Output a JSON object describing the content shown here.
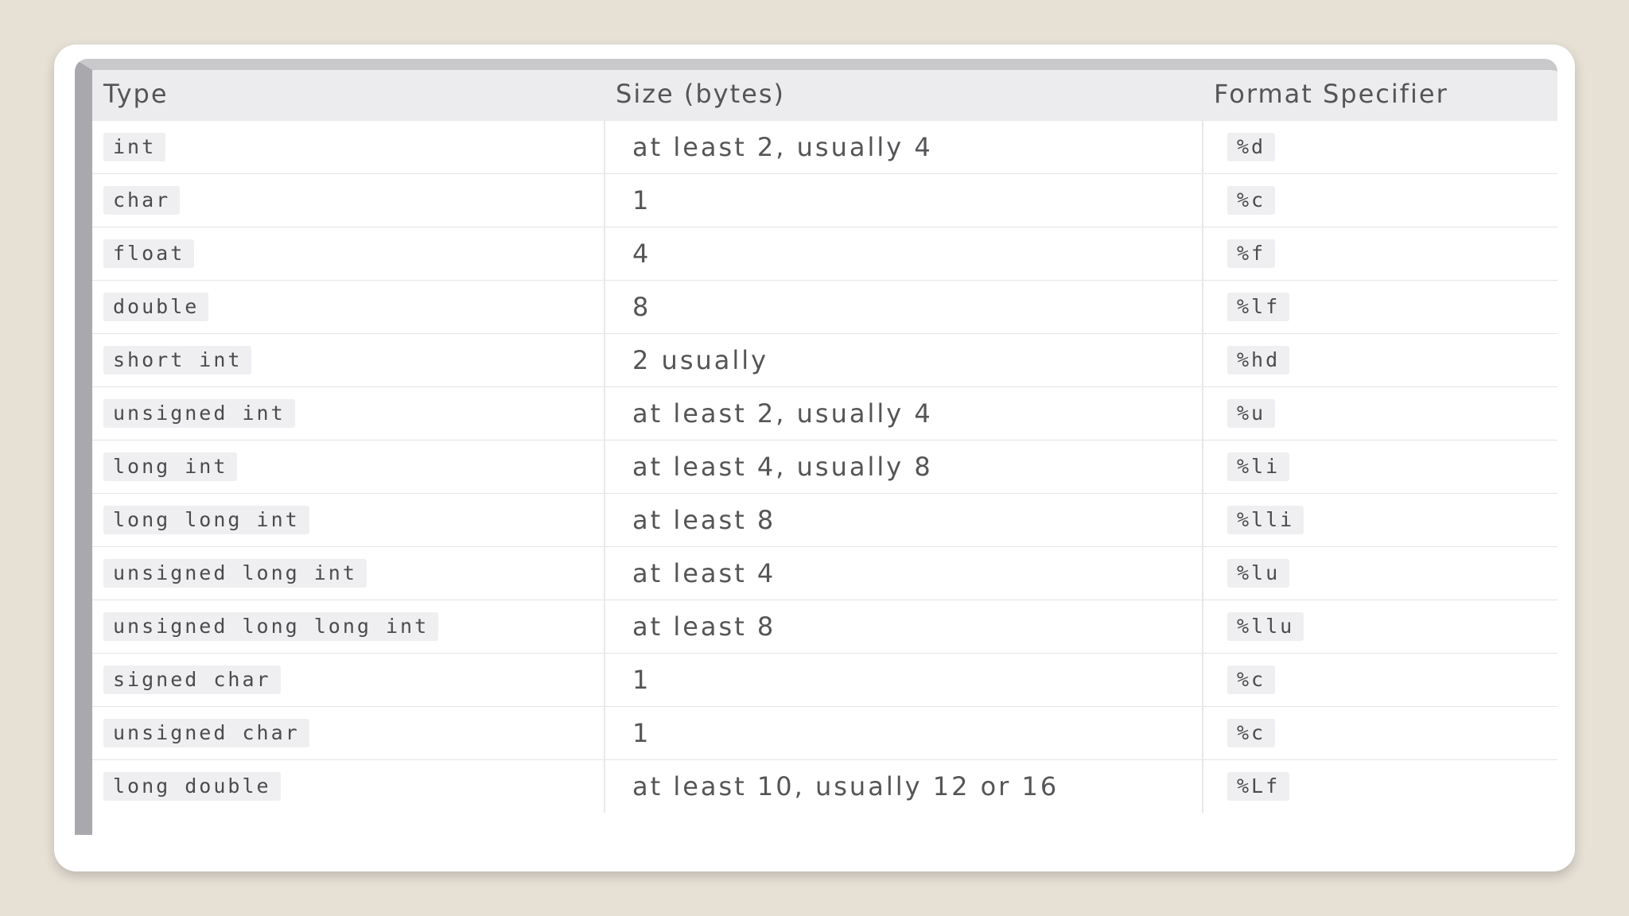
{
  "table": {
    "headers": {
      "type": "Type",
      "size": "Size (bytes)",
      "format": "Format Specifier"
    },
    "rows": [
      {
        "type": "int",
        "size": "at least 2, usually 4",
        "format": "%d"
      },
      {
        "type": "char",
        "size": "1",
        "format": "%c"
      },
      {
        "type": "float",
        "size": "4",
        "format": "%f"
      },
      {
        "type": "double",
        "size": "8",
        "format": "%lf"
      },
      {
        "type": "short int",
        "size": "2 usually",
        "format": "%hd"
      },
      {
        "type": "unsigned int",
        "size": "at least 2, usually 4",
        "format": "%u"
      },
      {
        "type": "long int",
        "size": "at least 4, usually 8",
        "format": "%li"
      },
      {
        "type": "long long int",
        "size": "at least 8",
        "format": "%lli"
      },
      {
        "type": "unsigned long int",
        "size": "at least 4",
        "format": "%lu"
      },
      {
        "type": "unsigned long long int",
        "size": "at least 8",
        "format": "%llu"
      },
      {
        "type": "signed char",
        "size": "1",
        "format": "%c"
      },
      {
        "type": "unsigned char",
        "size": "1",
        "format": "%c"
      },
      {
        "type": "long double",
        "size": "at least 10, usually 12 or 16",
        "format": "%Lf"
      }
    ]
  }
}
